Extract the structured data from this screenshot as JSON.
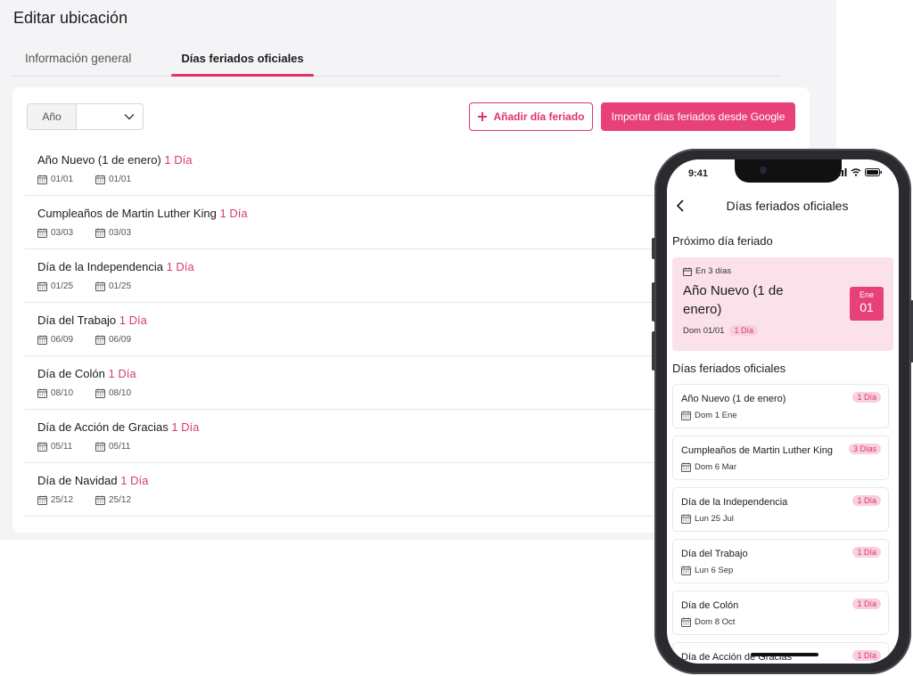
{
  "desktop": {
    "title": "Editar ubicación",
    "tabs": [
      {
        "label": "Información general",
        "active": false
      },
      {
        "label": "Días feriados oficiales",
        "active": true
      }
    ],
    "year_select": {
      "label": "Año",
      "value": ""
    },
    "add_button": "Añadir día feriado",
    "import_button": "Importar días feriados desde Google",
    "holidays": [
      {
        "name": "Año Nuevo (1 de enero)",
        "duration": "1 Día",
        "start": "01/01",
        "end": "01/01"
      },
      {
        "name": "Cumpleaños de Martin Luther King",
        "duration": "1 Día",
        "start": "03/03",
        "end": "03/03"
      },
      {
        "name": "Día de la Independencia",
        "duration": "1 Día",
        "start": "01/25",
        "end": "01/25"
      },
      {
        "name": "Día del Trabajo",
        "duration": "1 Día",
        "start": "06/09",
        "end": "06/09"
      },
      {
        "name": "Día de Colón",
        "duration": "1 Día",
        "start": "08/10",
        "end": "08/10"
      },
      {
        "name": "Día de Acción de Gracias",
        "duration": "1 Día",
        "start": "05/11",
        "end": "05/11"
      },
      {
        "name": "Día de Navidad",
        "duration": "1 Día",
        "start": "25/12",
        "end": "25/12"
      }
    ]
  },
  "phone": {
    "status_time": "9:41",
    "header_title": "Días feriados oficiales",
    "next_section": "Próximo día feriado",
    "next": {
      "in": "En 3 días",
      "name": "Año Nuevo (1 de enero)",
      "date": "Dom 01/01",
      "duration": "1 Día",
      "badge_month": "Ene",
      "badge_day": "01"
    },
    "list_section": "Días feriados oficiales",
    "holidays": [
      {
        "name": "Año Nuevo (1 de enero)",
        "duration": "1 Día",
        "date": "Dom 1 Ene"
      },
      {
        "name": "Cumpleaños de Martin Luther King",
        "duration": "3 Días",
        "date": "Dom 6 Mar"
      },
      {
        "name": "Día de la Independencia",
        "duration": "1 Día",
        "date": "Lun 25 Jul"
      },
      {
        "name": "Día del Trabajo",
        "duration": "1 Día",
        "date": "Lun 6 Sep"
      },
      {
        "name": "Día de Colón",
        "duration": "1 Día",
        "date": "Dom 8 Oct"
      },
      {
        "name": "Día de Acción de Gracias",
        "duration": "1 Día",
        "date": ""
      }
    ]
  },
  "colors": {
    "accent": "#e0336e",
    "accent_light": "#fbe1ea",
    "pill_bg": "#f9cfdd"
  },
  "icons": [
    "calendar-icon",
    "chevron-down-icon",
    "plus-icon",
    "back-chevron-icon",
    "signal-icon",
    "wifi-icon",
    "battery-icon"
  ]
}
